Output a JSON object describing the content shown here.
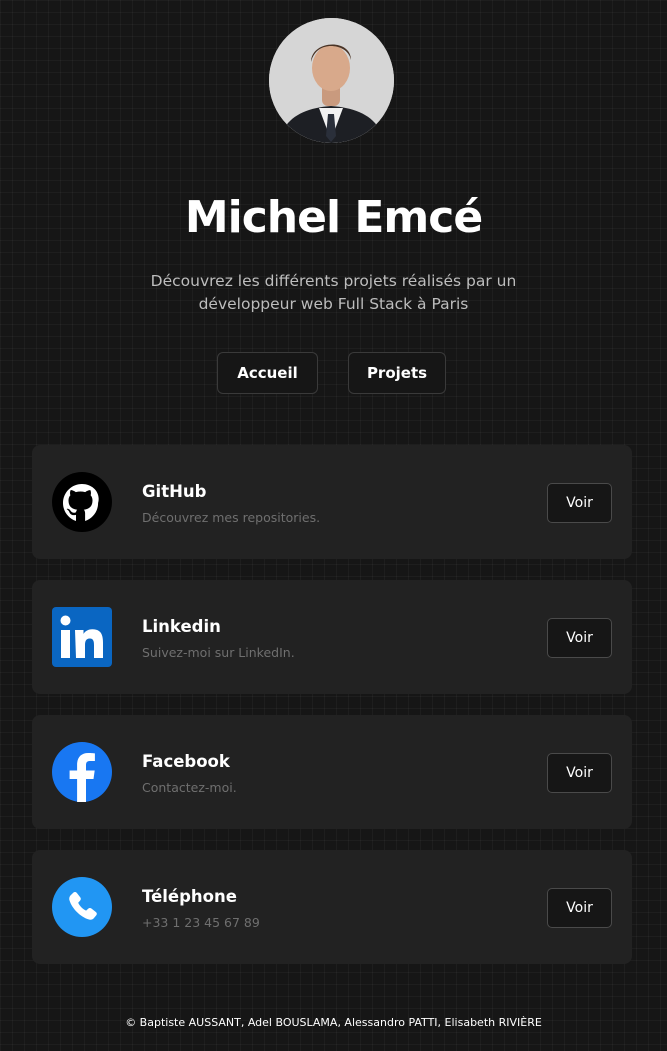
{
  "profile": {
    "name": "Michel Emcé",
    "tagline": "Découvrez les différents projets réalisés par un développeur web Full Stack à Paris"
  },
  "nav": {
    "home_label": "Accueil",
    "projects_label": "Projets"
  },
  "links": [
    {
      "name": "GitHub",
      "description": "Découvrez mes repositories.",
      "icon": "github-icon",
      "action": "Voir",
      "color": "#000000"
    },
    {
      "name": "Linkedin",
      "description": "Suivez-moi sur LinkedIn.",
      "icon": "linkedin-icon",
      "action": "Voir",
      "color": "#0a66c2"
    },
    {
      "name": "Facebook",
      "description": "Contactez-moi.",
      "icon": "facebook-icon",
      "action": "Voir",
      "color": "#1877f2"
    },
    {
      "name": "Téléphone",
      "description": "+33 1 23 45 67 89",
      "icon": "phone-icon",
      "action": "Voir",
      "color": "#2196f3"
    }
  ],
  "footer": {
    "text": "© Baptiste AUSSANT, Adel BOUSLAMA,  Alessandro PATTI,  Elisabeth RIVIÈRE"
  },
  "theme": {
    "background": "#161616",
    "card": "#222222",
    "muted_text": "#6f6f6f"
  }
}
